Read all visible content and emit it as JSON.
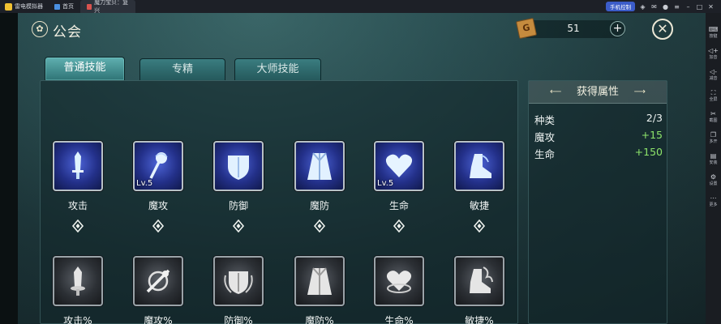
{
  "emulator": {
    "app_name": "雷电模拟器",
    "tabs": [
      {
        "label": "首页"
      },
      {
        "label": "魔力宝贝：复兴"
      }
    ],
    "badge": "手机控制",
    "sidebar": [
      {
        "label": "按键"
      },
      {
        "label": "加音"
      },
      {
        "label": "减音"
      },
      {
        "label": "全屏"
      },
      {
        "label": "截图"
      },
      {
        "label": "多开"
      },
      {
        "label": "安装"
      },
      {
        "label": "设置"
      },
      {
        "label": "更多"
      }
    ]
  },
  "header": {
    "title": "公会",
    "currency_value": "51",
    "currency_icon": "G"
  },
  "tabs": [
    {
      "label": "普通技能",
      "active": true
    },
    {
      "label": "专精",
      "active": false
    },
    {
      "label": "大师技能",
      "active": false
    }
  ],
  "skills_row1": [
    {
      "name": "攻击",
      "level": "",
      "icon": "sword-icon"
    },
    {
      "name": "魔攻",
      "level": "Lv.5",
      "icon": "magic-staff-icon"
    },
    {
      "name": "防御",
      "level": "",
      "icon": "shield-icon"
    },
    {
      "name": "魔防",
      "level": "",
      "icon": "robe-icon"
    },
    {
      "name": "生命",
      "level": "Lv.5",
      "icon": "heart-icon"
    },
    {
      "name": "敏捷",
      "level": "",
      "icon": "boot-icon"
    }
  ],
  "skills_row2": [
    {
      "name": "攻击%",
      "icon": "sword-percent-icon"
    },
    {
      "name": "魔攻%",
      "icon": "magic-percent-icon"
    },
    {
      "name": "防御%",
      "icon": "shield-percent-icon"
    },
    {
      "name": "魔防%",
      "icon": "robe-percent-icon"
    },
    {
      "name": "生命%",
      "icon": "heart-percent-icon"
    },
    {
      "name": "敏捷%",
      "icon": "boot-percent-icon"
    }
  ],
  "attributes": {
    "title": "获得属性",
    "rows": [
      {
        "key": "种类",
        "value": "2/3",
        "color": "#eef3f2"
      },
      {
        "key": "魔攻",
        "value": "+15",
        "color": "#8ee56b"
      },
      {
        "key": "生命",
        "value": "+150",
        "color": "#8ee56b"
      }
    ]
  }
}
